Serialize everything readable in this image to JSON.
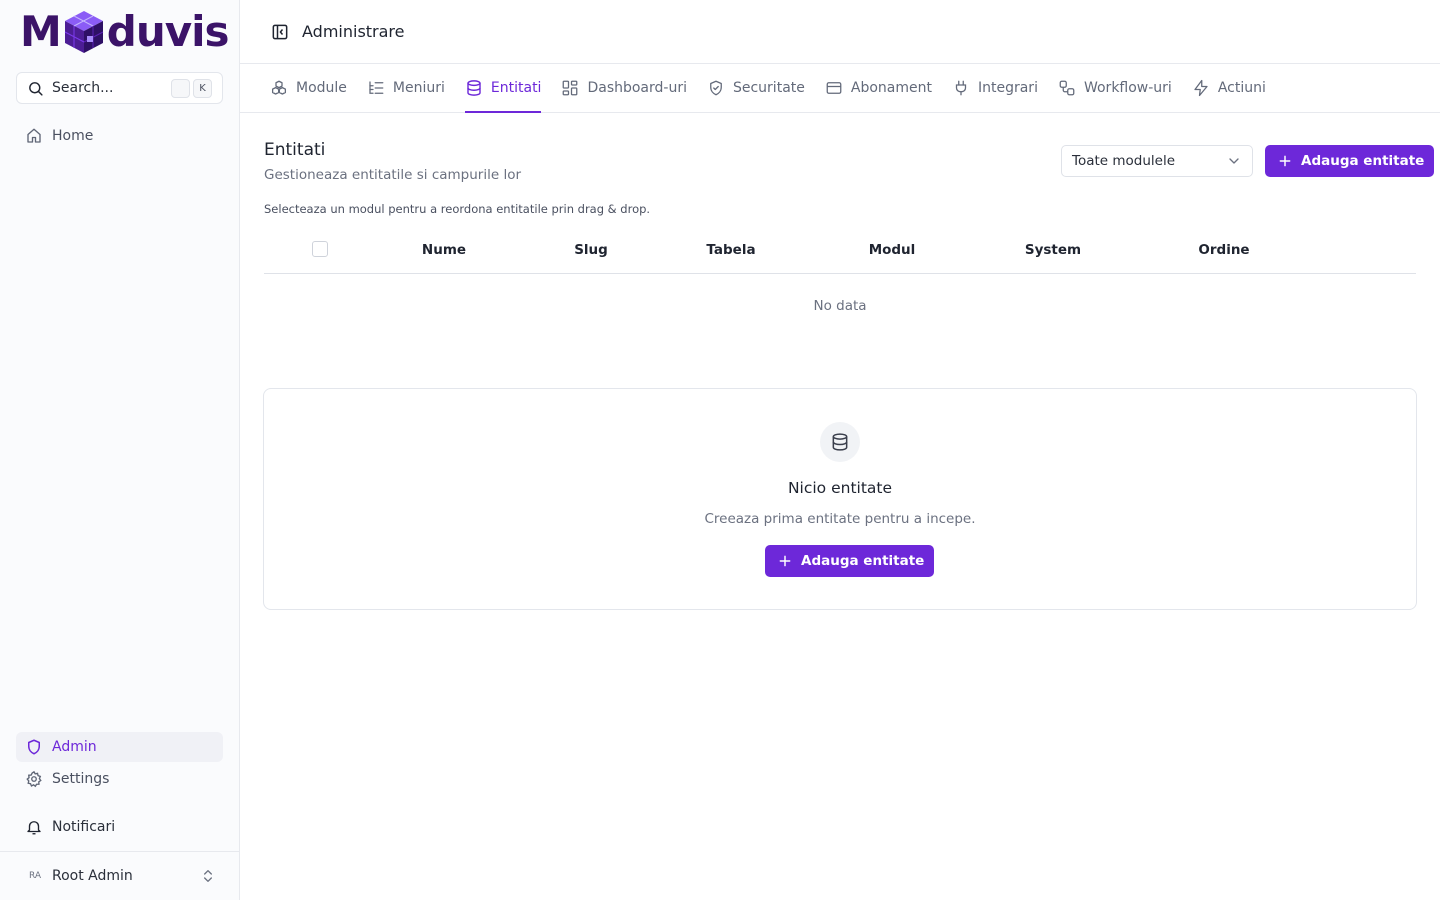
{
  "logo": {
    "prefix": "M",
    "suffix": "duvis"
  },
  "search": {
    "label": "Search...",
    "shortcut_key": "K"
  },
  "sidebar": {
    "top_items": [
      {
        "label": "Home",
        "icon": "home-icon"
      }
    ],
    "bottom_items": [
      {
        "label": "Admin",
        "icon": "shield-icon",
        "active": true
      },
      {
        "label": "Settings",
        "icon": "gear-icon"
      },
      {
        "label": "Notificari",
        "icon": "bell-icon"
      }
    ],
    "user": {
      "initials": "RA",
      "name": "Root Admin"
    }
  },
  "header": {
    "title": "Administrare"
  },
  "tabs": [
    {
      "label": "Module",
      "icon": "boxes-icon"
    },
    {
      "label": "Meniuri",
      "icon": "list-tree-icon"
    },
    {
      "label": "Entitati",
      "icon": "database-icon",
      "active": true
    },
    {
      "label": "Dashboard-uri",
      "icon": "layout-dashboard-icon"
    },
    {
      "label": "Securitate",
      "icon": "shield-check-icon"
    },
    {
      "label": "Abonament",
      "icon": "credit-card-icon"
    },
    {
      "label": "Integrari",
      "icon": "plug-icon"
    },
    {
      "label": "Workflow-uri",
      "icon": "workflow-icon"
    },
    {
      "label": "Actiuni",
      "icon": "zap-icon"
    }
  ],
  "main": {
    "title": "Entitati",
    "subtitle": "Gestioneaza entitatile si campurile lor",
    "module_filter": {
      "selected": "Toate modulele"
    },
    "add_button_label": "Adauga entitate",
    "hint": "Selecteaza un modul pentru a reordona entitatile prin drag & drop.",
    "table": {
      "columns": [
        "Nume",
        "Slug",
        "Tabela",
        "Modul",
        "System",
        "Ordine"
      ],
      "rows": [],
      "empty_text": "No data"
    },
    "empty_state": {
      "title": "Nicio entitate",
      "subtitle": "Creeaza prima entitate pentru a incepe.",
      "button_label": "Adauga entitate"
    }
  },
  "colors": {
    "accent": "#6d28d9",
    "brand": "#3b1368"
  }
}
